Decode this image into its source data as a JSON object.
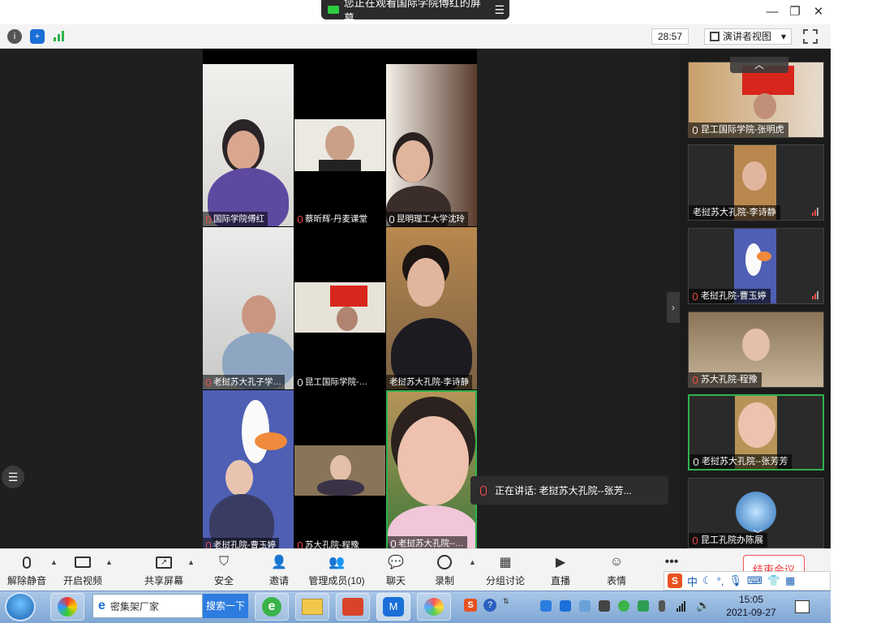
{
  "share_banner": {
    "text": "您正在观看国际学院傅红的屏幕",
    "menu_icon": "menu-icon"
  },
  "window_controls": {
    "minimize": "—",
    "restore": "❐",
    "close": "✕"
  },
  "top_toolbar": {
    "timer": "28:57",
    "view_mode": "演讲者视图",
    "view_caret": "▾"
  },
  "gallery": {
    "tiles": [
      {
        "name": "国际学院傅红",
        "muted": true
      },
      {
        "name": "蔡昕辉-丹麦课堂",
        "muted": true
      },
      {
        "name": "昆明理工大学沈玲",
        "muted": false
      },
      {
        "name": "老挝苏大孔子学…",
        "muted": true
      },
      {
        "name": "昆工国际学院-…",
        "muted": false
      },
      {
        "name": "老挝苏大孔院-李诗静",
        "muted": false
      },
      {
        "name": "老挝孔院-曹玉婷",
        "muted": true
      },
      {
        "name": "苏大孔院-程豫",
        "muted": true
      },
      {
        "name": "老挝苏大孔院--…",
        "muted": false
      }
    ]
  },
  "speaker_toast": {
    "text": "正在讲话: 老挝苏大孔院--张芳..."
  },
  "sidebar": {
    "up": "︿",
    "down": "﹀",
    "tiles": [
      {
        "name": "昆工国际学院-张明虎",
        "muted": false
      },
      {
        "name": "老挝苏大孔院-李诗静",
        "muted": false
      },
      {
        "name": "老挝孔院-曹玉婷",
        "muted": true
      },
      {
        "name": "苏大孔院-程豫",
        "muted": true
      },
      {
        "name": "老挝苏大孔院--张芳芳",
        "muted": false
      },
      {
        "name": "昆工孔院办陈展",
        "muted": true
      }
    ]
  },
  "bottom_toolbar": {
    "items": [
      {
        "label": "解除静音",
        "icon": "mic-muted-icon"
      },
      {
        "label": "开启视频",
        "icon": "video-off-icon"
      },
      {
        "label": "共享屏幕",
        "icon": "share-screen-icon"
      },
      {
        "label": "安全",
        "icon": "shield-icon"
      },
      {
        "label": "邀请",
        "icon": "invite-icon"
      },
      {
        "label": "管理成员(10)",
        "icon": "participants-icon"
      },
      {
        "label": "聊天",
        "icon": "chat-icon"
      },
      {
        "label": "录制",
        "icon": "record-icon"
      },
      {
        "label": "分组讨论",
        "icon": "breakout-icon"
      },
      {
        "label": "直播",
        "icon": "live-icon"
      },
      {
        "label": "表情",
        "icon": "emoji-icon"
      },
      {
        "label": "多",
        "icon": "more-icon"
      }
    ],
    "end_meeting": "结束会议"
  },
  "ime": {
    "lang": "中"
  },
  "taskbar": {
    "search_text": "密集架厂家",
    "search_button": "搜索一下",
    "time": "15:05",
    "date": "2021-09-27"
  }
}
